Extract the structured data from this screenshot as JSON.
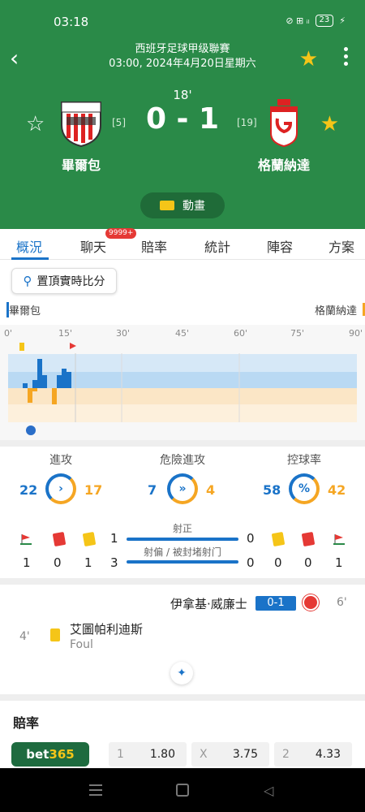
{
  "status": {
    "time": "03:18",
    "icons": "⊘ ⊞ ᵢₗ",
    "battery": "23"
  },
  "match": {
    "league": "西班牙足球甲级聯賽",
    "datetime": "03:00, 2024年4月20日星期六",
    "minute": "18'",
    "score": "0 - 1",
    "home": {
      "name": "畢爾包",
      "rank": "[5]"
    },
    "away": {
      "name": "格蘭納達",
      "rank": "[19]"
    },
    "animation_label": "動畫"
  },
  "tabs": [
    {
      "label": "概況"
    },
    {
      "label": "聊天",
      "badge": "9999+"
    },
    {
      "label": "賠率"
    },
    {
      "label": "統計"
    },
    {
      "label": "陣容"
    },
    {
      "label": "方案"
    }
  ],
  "pin_label": "置頂實時比分",
  "timeline": {
    "home": "畢爾包",
    "away": "格蘭納達",
    "ticks": [
      "0'",
      "15'",
      "30'",
      "45'",
      "60'",
      "75'",
      "90'"
    ]
  },
  "stats": [
    {
      "title": "進攻",
      "home": "22",
      "away": "17",
      "icon": "›"
    },
    {
      "title": "危險進攻",
      "home": "7",
      "away": "4",
      "icon": "»"
    },
    {
      "title": "控球率",
      "home": "58",
      "away": "42",
      "icon": "%"
    }
  ],
  "cards": {
    "home": {
      "corners": "1",
      "red": "0",
      "yellow": "1"
    },
    "away": {
      "corners": "1",
      "red": "0",
      "yellow": "0"
    },
    "shots_on": {
      "label": "射正",
      "home": "1",
      "away": "0"
    },
    "shots_off": {
      "label": "射偏 / 被封堵射门",
      "home": "3",
      "away": "0"
    }
  },
  "events": {
    "goal": {
      "player": "伊拿基·威廉士",
      "score": "0-1",
      "minute": "6'"
    },
    "card": {
      "minute": "4'",
      "player": "艾圖帕利迪斯",
      "reason": "Foul"
    }
  },
  "odds": {
    "title": "賠率",
    "bookmaker_a": "bet",
    "bookmaker_b": "365",
    "items": [
      {
        "key": "1",
        "value": "1.80"
      },
      {
        "key": "X",
        "value": "3.75"
      },
      {
        "key": "2",
        "value": "4.33"
      }
    ]
  }
}
